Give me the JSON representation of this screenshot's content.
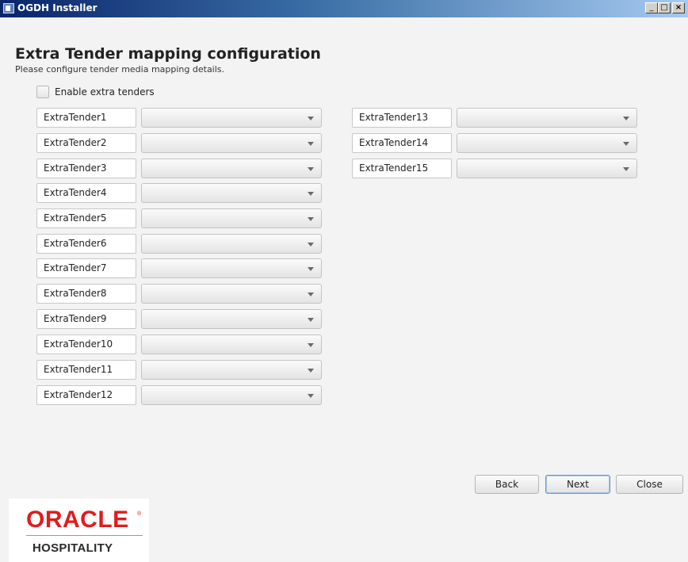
{
  "window": {
    "title": "OGDH Installer",
    "buttons": {
      "minimize": "_",
      "maximize": "□",
      "close": "×"
    }
  },
  "page": {
    "heading": "Extra Tender mapping configuration",
    "subheading": "Please configure tender media mapping details."
  },
  "enable": {
    "label": "Enable extra tenders",
    "checked": false
  },
  "tenders": [
    {
      "label": "ExtraTender1",
      "value": ""
    },
    {
      "label": "ExtraTender2",
      "value": ""
    },
    {
      "label": "ExtraTender3",
      "value": ""
    },
    {
      "label": "ExtraTender4",
      "value": ""
    },
    {
      "label": "ExtraTender5",
      "value": ""
    },
    {
      "label": "ExtraTender6",
      "value": ""
    },
    {
      "label": "ExtraTender7",
      "value": ""
    },
    {
      "label": "ExtraTender8",
      "value": ""
    },
    {
      "label": "ExtraTender9",
      "value": ""
    },
    {
      "label": "ExtraTender10",
      "value": ""
    },
    {
      "label": "ExtraTender11",
      "value": ""
    },
    {
      "label": "ExtraTender12",
      "value": ""
    },
    {
      "label": "ExtraTender13",
      "value": ""
    },
    {
      "label": "ExtraTender14",
      "value": ""
    },
    {
      "label": "ExtraTender15",
      "value": ""
    }
  ],
  "nav": {
    "back": "Back",
    "next": "Next",
    "close": "Close"
  },
  "logo": {
    "brand": "ORACLE",
    "registered": "®",
    "product": "HOSPITALITY"
  },
  "colors": {
    "titlebar": "#0a246a",
    "brand_red": "#e21b1b",
    "default_button_border": "#6a95c8"
  }
}
